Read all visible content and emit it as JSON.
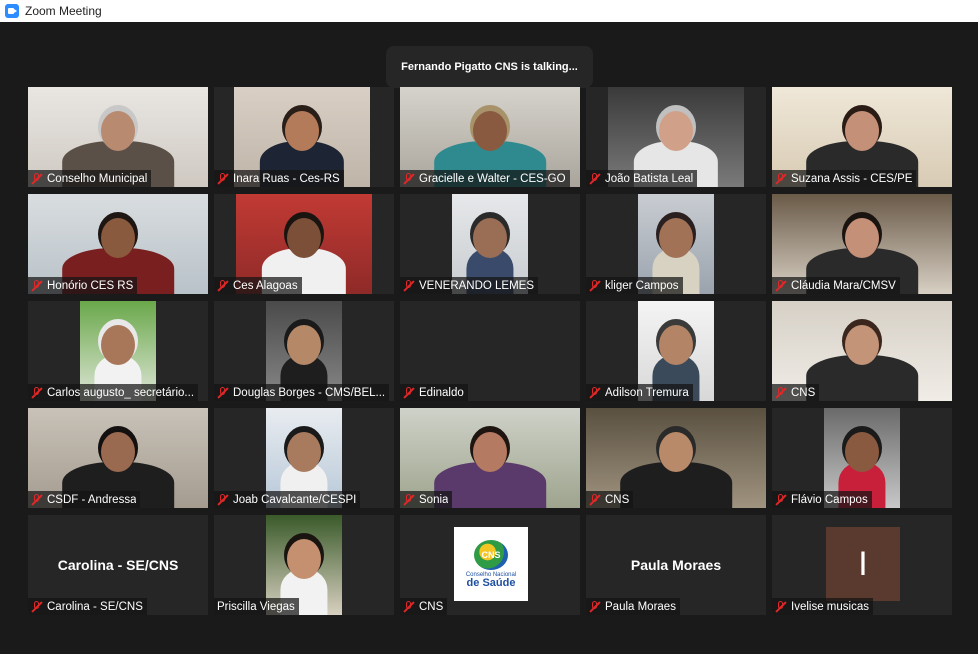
{
  "window": {
    "app_icon": "zoom-camera-icon",
    "title": "Zoom Meeting"
  },
  "banner": {
    "talking": "Fernando Pigatto CNS is talking..."
  },
  "participants": [
    {
      "name": "Conselho Municipal",
      "muted": true,
      "kind": "video"
    },
    {
      "name": "Inara Ruas  - Ces-RS",
      "muted": true,
      "kind": "video"
    },
    {
      "name": "Gracielle e Walter - CES-GO",
      "muted": true,
      "kind": "video"
    },
    {
      "name": "João Batista Leal",
      "muted": true,
      "kind": "video"
    },
    {
      "name": "Suzana Assis - CES/PE",
      "muted": true,
      "kind": "video"
    },
    {
      "name": "Honório CES RS",
      "muted": true,
      "kind": "video"
    },
    {
      "name": "Ces Alagoas",
      "muted": true,
      "kind": "video"
    },
    {
      "name": "VENERANDO LEMES",
      "muted": true,
      "kind": "video"
    },
    {
      "name": "kliger Campos",
      "muted": true,
      "kind": "video"
    },
    {
      "name": "Cláudia Mara/CMSV",
      "muted": true,
      "kind": "video"
    },
    {
      "name": "Carlos augusto_ secretário...",
      "muted": true,
      "kind": "video"
    },
    {
      "name": "Douglas Borges - CMS/BEL...",
      "muted": true,
      "kind": "video"
    },
    {
      "name": "Edinaldo",
      "muted": true,
      "kind": "empty"
    },
    {
      "name": "Adilson Tremura",
      "muted": true,
      "kind": "video"
    },
    {
      "name": "CNS",
      "muted": true,
      "kind": "video"
    },
    {
      "name": "CSDF - Andressa",
      "muted": true,
      "kind": "video"
    },
    {
      "name": "Joab Cavalcante/CESPI",
      "muted": true,
      "kind": "video"
    },
    {
      "name": "Sonia",
      "muted": true,
      "kind": "video"
    },
    {
      "name": "CNS",
      "muted": true,
      "kind": "video"
    },
    {
      "name": "Flávio Campos",
      "muted": true,
      "kind": "video"
    },
    {
      "name": "Carolina - SE/CNS",
      "muted": true,
      "kind": "name_only",
      "display_name": "Carolina - SE/CNS"
    },
    {
      "name": "Priscilla Viegas",
      "muted": false,
      "kind": "video"
    },
    {
      "name": "CNS",
      "muted": true,
      "kind": "logo",
      "logo": {
        "top": "CNS",
        "line1": "Conselho Nacional",
        "line2": "de Saúde"
      }
    },
    {
      "name": "Paula Moraes",
      "muted": true,
      "kind": "name_only",
      "display_name": "Paula Moraes"
    },
    {
      "name": "Ivelise musicas",
      "muted": true,
      "kind": "avatar",
      "avatar_text": "I"
    }
  ],
  "colors": {
    "background": "#1a1a1a",
    "tile": "#262626",
    "mute_red": "#e02828",
    "zoom_blue": "#2d8cff"
  }
}
